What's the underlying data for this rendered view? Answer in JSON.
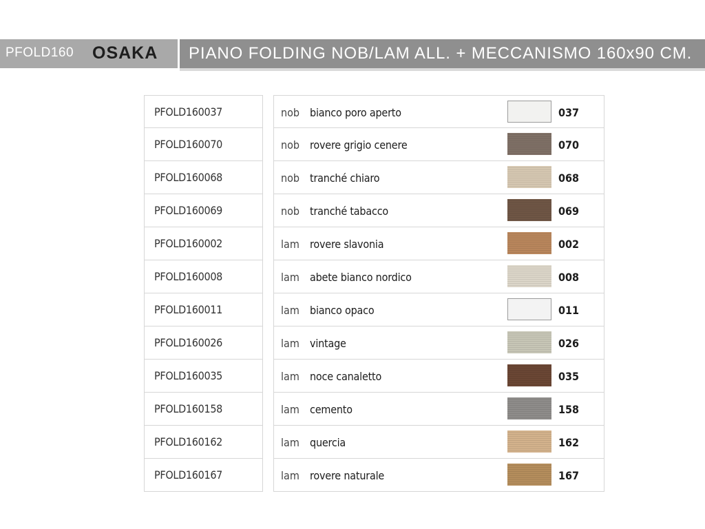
{
  "header": {
    "code": "PFOLD160",
    "name": "OSAKA",
    "description": "PIANO FOLDING NOB/LAM ALL. + MECCANISMO 160x90 CM."
  },
  "rows": [
    {
      "code": "PFOLD160037",
      "type": "nob",
      "finish": "bianco poro aperto",
      "number": "037",
      "color": "#f2f2f0"
    },
    {
      "code": "PFOLD160070",
      "type": "nob",
      "finish": "rovere grigio cenere",
      "number": "070",
      "color": "#7f7066"
    },
    {
      "code": "PFOLD160068",
      "type": "nob",
      "finish": "tranché chiaro",
      "number": "068",
      "color": "#d6c8b2"
    },
    {
      "code": "PFOLD160069",
      "type": "nob",
      "finish": "tranché tabacco",
      "number": "069",
      "color": "#6f5645"
    },
    {
      "code": "PFOLD160002",
      "type": "lam",
      "finish": "rovere slavonia",
      "number": "002",
      "color": "#b9865c"
    },
    {
      "code": "PFOLD160008",
      "type": "lam",
      "finish": "abete bianco nordico",
      "number": "008",
      "color": "#dcd6c9"
    },
    {
      "code": "PFOLD160011",
      "type": "lam",
      "finish": "bianco opaco",
      "number": "011",
      "color": "#f3f3f3"
    },
    {
      "code": "PFOLD160026",
      "type": "lam",
      "finish": "vintage",
      "number": "026",
      "color": "#c7c6b6"
    },
    {
      "code": "PFOLD160035",
      "type": "lam",
      "finish": "noce canaletto",
      "number": "035",
      "color": "#6a4634"
    },
    {
      "code": "PFOLD160158",
      "type": "lam",
      "finish": "cemento",
      "number": "158",
      "color": "#8e8c8a"
    },
    {
      "code": "PFOLD160162",
      "type": "lam",
      "finish": "quercia",
      "number": "162",
      "color": "#d3b28c"
    },
    {
      "code": "PFOLD160167",
      "type": "lam",
      "finish": "rovere naturale",
      "number": "167",
      "color": "#b48d5c"
    }
  ]
}
